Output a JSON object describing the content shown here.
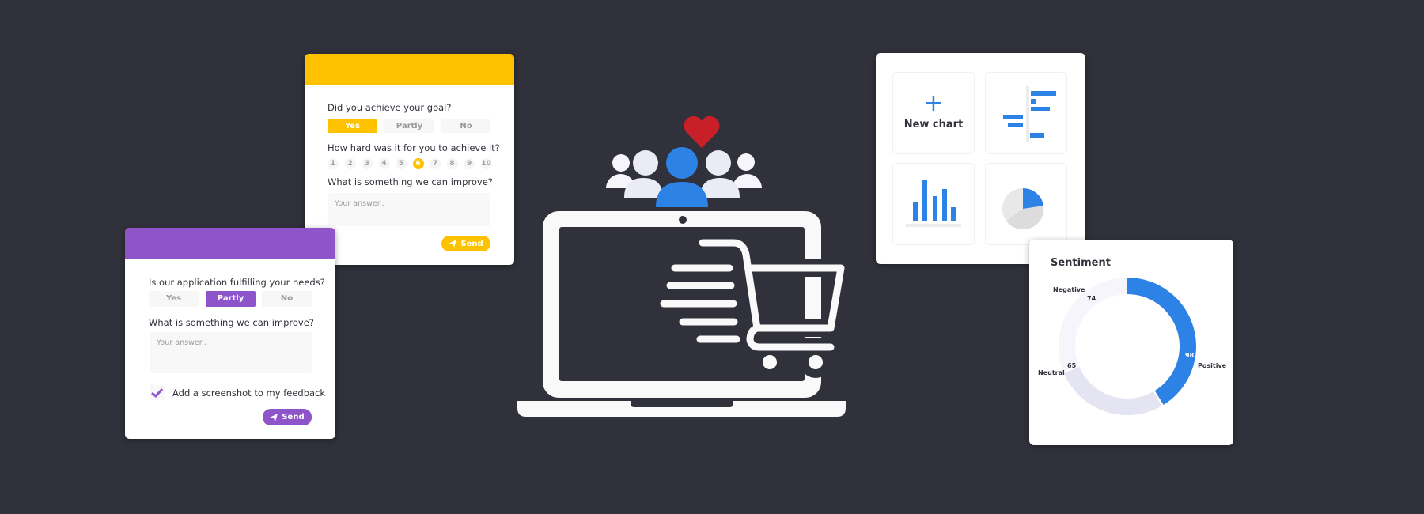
{
  "colors": {
    "background": "#31313b",
    "yellow": "#ffc200",
    "purple": "#8e54c9",
    "blue": "#2d82e5",
    "heart": "#c81f28",
    "neutral": "#e5e4f3",
    "negative": "#f6f5fb"
  },
  "goal_survey": {
    "question1": "Did you achieve your goal?",
    "options": [
      {
        "label": "Yes",
        "selected": true
      },
      {
        "label": "Partly",
        "selected": false
      },
      {
        "label": "No",
        "selected": false
      }
    ],
    "question2": "How hard was it for you to achieve it?",
    "scale": [
      "1",
      "2",
      "3",
      "4",
      "5",
      "6",
      "7",
      "8",
      "9",
      "10"
    ],
    "scale_selected": "6",
    "question3": "What is something we can improve?",
    "placeholder": "Your answer..",
    "send_label": "Send"
  },
  "needs_survey": {
    "question1": "Is our application fulfilling your needs?",
    "options": [
      {
        "label": "Yes",
        "selected": false
      },
      {
        "label": "Partly",
        "selected": true
      },
      {
        "label": "No",
        "selected": false
      }
    ],
    "question2": "What is something we can improve?",
    "placeholder": "Your answer..",
    "checkbox_label": "Add a screenshot to my feedback",
    "checkbox_checked": true,
    "send_label": "Send"
  },
  "chart_picker": {
    "new_chart_label": "New chart",
    "tiles": [
      "new-chart",
      "diverging-bar-chart",
      "column-chart",
      "pie-chart"
    ]
  },
  "illustration": {
    "icons": [
      "heart-icon",
      "users-icon",
      "laptop-icon",
      "shopping-cart-icon"
    ]
  },
  "chart_data": {
    "type": "pie",
    "title": "Sentiment",
    "donut": true,
    "categories": [
      "Positive",
      "Neutral",
      "Negative"
    ],
    "values": [
      98,
      65,
      74
    ],
    "value_labels": [
      "98",
      "65",
      "74"
    ],
    "colors": [
      "#2d82e5",
      "#e5e4f3",
      "#f6f5fb"
    ]
  }
}
